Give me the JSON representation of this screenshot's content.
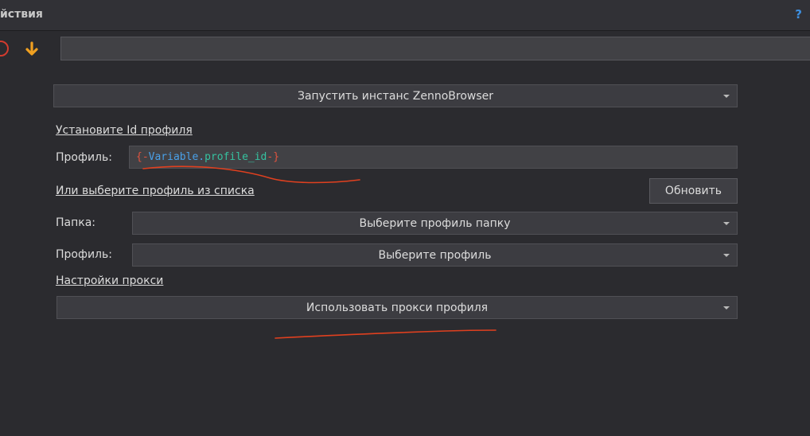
{
  "window": {
    "title": "йствия",
    "help_label": "?"
  },
  "toolbar": {
    "stop_icon": "stop-circle-icon",
    "down_icon": "arrow-down-icon",
    "input_value": ""
  },
  "action": {
    "selected": "Запустить инстанс ZennoBrowser"
  },
  "profile_id_section": {
    "link": "Установите Id профиля",
    "label": "Профиль:",
    "value_open": "{-",
    "value_var": "Variable",
    "value_dot": ".",
    "value_prop": "profile_id",
    "value_close": "-}"
  },
  "profile_list_section": {
    "link": "Или выберите профиль из списка",
    "refresh_label": "Обновить",
    "folder_label": "Папка:",
    "folder_selected": "Выберите профиль папку",
    "profile_label": "Профиль:",
    "profile_selected": "Выберите профиль"
  },
  "proxy_section": {
    "link": "Настройки прокси",
    "selected": "Использовать прокси профиля"
  },
  "colors": {
    "background": "#2b2b2f",
    "help": "#3d8fe0",
    "arrow": "#f0a020",
    "stop": "#d23b2e",
    "annotation": "#e0401f"
  }
}
